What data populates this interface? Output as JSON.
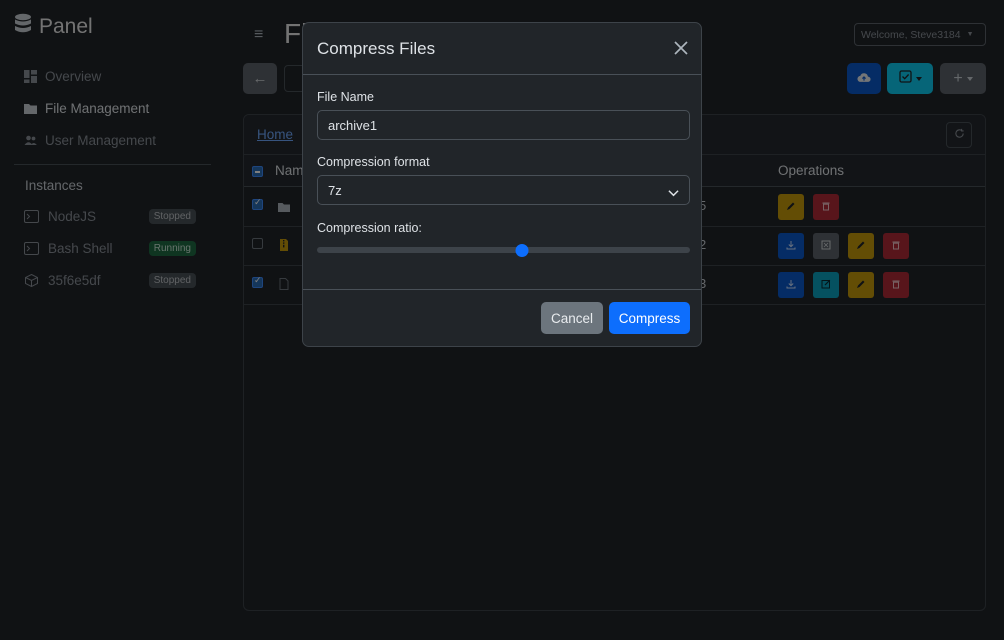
{
  "brand": {
    "name": "Panel",
    "icon": "database-icon"
  },
  "nav": [
    {
      "label": "Overview",
      "icon": "dashboard-icon",
      "active": false
    },
    {
      "label": "File Management",
      "icon": "folder-icon",
      "active": true
    },
    {
      "label": "User Management",
      "icon": "users-icon",
      "active": false
    }
  ],
  "instances": {
    "title": "Instances",
    "items": [
      {
        "name": "NodeJS",
        "status": "Stopped",
        "icon": "terminal-icon"
      },
      {
        "name": "Bash Shell",
        "status": "Running",
        "icon": "terminal-icon"
      },
      {
        "name": "35f6e5df",
        "status": "Stopped",
        "icon": "cube-icon"
      }
    ]
  },
  "header": {
    "page_title": "Fi",
    "welcome": "Welcome, Steve3184",
    "back_icon": "arrow-left-icon",
    "upload_icon": "cloud-upload-icon",
    "select_icon": "check-square-icon",
    "add_icon": "plus-icon"
  },
  "card": {
    "breadcrumb_home": "Home",
    "columns": {
      "name": "Nam",
      "operations": "Operations"
    },
    "rows": [
      {
        "checked": true,
        "icon": "folder-icon",
        "num": "5"
      },
      {
        "checked": false,
        "icon": "archive-icon",
        "num": "2"
      },
      {
        "checked": true,
        "icon": "file-icon",
        "num": "3"
      }
    ]
  },
  "modal": {
    "title": "Compress Files",
    "file_name_label": "File Name",
    "file_name_value": "archive1",
    "format_label": "Compression format",
    "format_value": "7z",
    "ratio_label": "Compression ratio:",
    "ratio_value": 0.55,
    "cancel_label": "Cancel",
    "compress_label": "Compress"
  },
  "colors": {
    "primary": "#0d6efd",
    "warning": "#c79a0a",
    "danger": "#b02a37",
    "info": "#0dcaf0",
    "secondary": "#6c757d"
  }
}
